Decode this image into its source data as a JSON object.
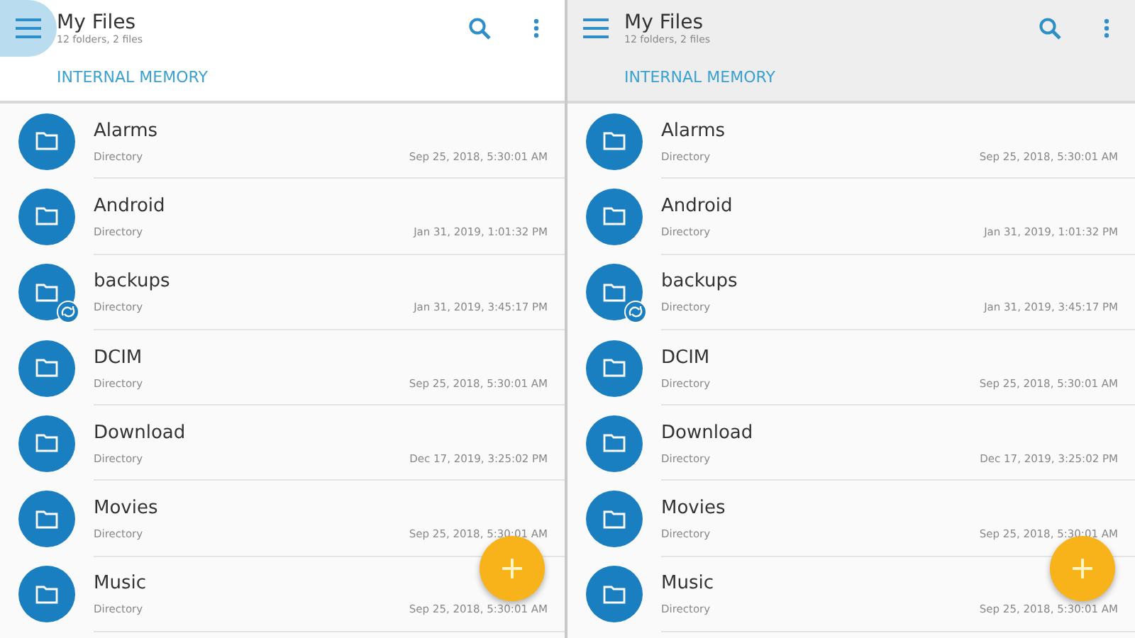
{
  "panes": [
    {
      "focused": true,
      "menu_pressed": true,
      "title": "My Files",
      "subtitle": "12 folders, 2 files",
      "tab": "INTERNAL MEMORY",
      "rows": [
        {
          "name": "Alarms",
          "type": "Directory",
          "date": "Sep 25, 2018, 5:30:01 AM",
          "badge": false
        },
        {
          "name": "Android",
          "type": "Directory",
          "date": "Jan 31, 2019, 1:01:32 PM",
          "badge": false
        },
        {
          "name": "backups",
          "type": "Directory",
          "date": "Jan 31, 2019, 3:45:17 PM",
          "badge": true
        },
        {
          "name": "DCIM",
          "type": "Directory",
          "date": "Sep 25, 2018, 5:30:01 AM",
          "badge": false
        },
        {
          "name": "Download",
          "type": "Directory",
          "date": "Dec 17, 2019, 3:25:02 PM",
          "badge": false
        },
        {
          "name": "Movies",
          "type": "Directory",
          "date": "Sep 25, 2018, 5:30:01 AM",
          "badge": false
        },
        {
          "name": "Music",
          "type": "Directory",
          "date": "Sep 25, 2018, 5:30:01 AM",
          "badge": false
        }
      ]
    },
    {
      "focused": false,
      "menu_pressed": false,
      "title": "My Files",
      "subtitle": "12 folders, 2 files",
      "tab": "INTERNAL MEMORY",
      "rows": [
        {
          "name": "Alarms",
          "type": "Directory",
          "date": "Sep 25, 2018, 5:30:01 AM",
          "badge": false
        },
        {
          "name": "Android",
          "type": "Directory",
          "date": "Jan 31, 2019, 1:01:32 PM",
          "badge": false
        },
        {
          "name": "backups",
          "type": "Directory",
          "date": "Jan 31, 2019, 3:45:17 PM",
          "badge": true
        },
        {
          "name": "DCIM",
          "type": "Directory",
          "date": "Sep 25, 2018, 5:30:01 AM",
          "badge": false
        },
        {
          "name": "Download",
          "type": "Directory",
          "date": "Dec 17, 2019, 3:25:02 PM",
          "badge": false
        },
        {
          "name": "Movies",
          "type": "Directory",
          "date": "Sep 25, 2018, 5:30:01 AM",
          "badge": false
        },
        {
          "name": "Music",
          "type": "Directory",
          "date": "Sep 25, 2018, 5:30:01 AM",
          "badge": false
        }
      ]
    }
  ]
}
